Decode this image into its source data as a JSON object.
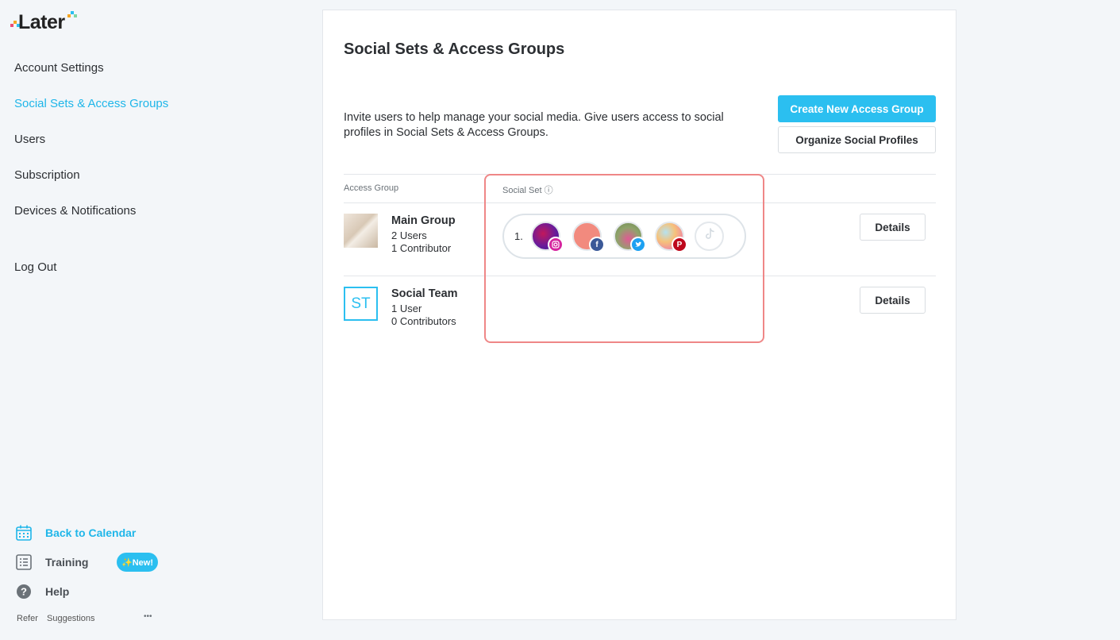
{
  "brand": {
    "logo_text": "Later",
    "accent": "#2bbff0"
  },
  "sidebar": {
    "items": [
      {
        "label": "Account Settings"
      },
      {
        "label": "Social Sets & Access Groups",
        "active": true
      },
      {
        "label": "Users"
      },
      {
        "label": "Subscription"
      },
      {
        "label": "Devices & Notifications"
      }
    ],
    "logout": "Log Out",
    "bottom": {
      "back_to_calendar": "Back to Calendar",
      "training": "Training",
      "new_badge": "✨New!",
      "help": "Help",
      "refer": "Refer",
      "suggestions": "Suggestions",
      "more": "•••"
    }
  },
  "main": {
    "title": "Social Sets & Access Groups",
    "description": "Invite users to help manage your social media. Give users access to social profiles in Social Sets & Access Groups.",
    "create_button": "Create New Access Group",
    "organize_button": "Organize Social Profiles",
    "columns": {
      "access_group": "Access Group",
      "social_set": "Social Set ⓘ"
    },
    "groups": [
      {
        "name": "Main Group",
        "users": "2 Users",
        "contributors": "1 Contributor",
        "details": "Details",
        "thumb": "image"
      },
      {
        "name": "Social Team",
        "users": "1 User",
        "contributors": "0 Contributors",
        "details": "Details",
        "thumb": "ST"
      }
    ],
    "social_set": {
      "number": "1.",
      "profiles": [
        {
          "network": "instagram",
          "icon": "instagram-icon",
          "badge_color": "#d6249f"
        },
        {
          "network": "facebook",
          "icon": "facebook-icon",
          "badge_color": "#3b5998",
          "badge_text": "f"
        },
        {
          "network": "twitter",
          "icon": "twitter-icon",
          "badge_color": "#1da1f2"
        },
        {
          "network": "pinterest",
          "icon": "pinterest-icon",
          "badge_color": "#bd081c",
          "badge_text": "P"
        },
        {
          "network": "tiktok",
          "icon": "tiktok-icon"
        }
      ]
    }
  }
}
